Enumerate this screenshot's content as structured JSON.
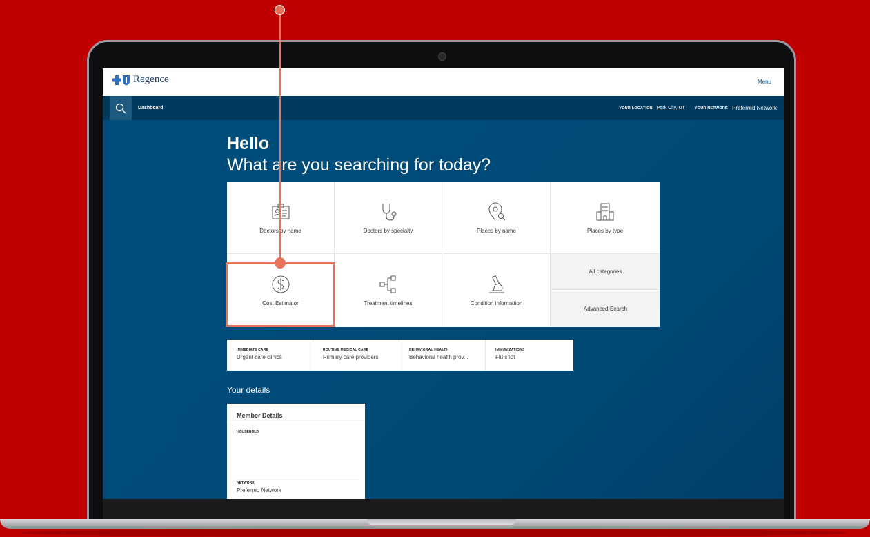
{
  "app": {
    "brand": "Regence",
    "menu_label": "Menu"
  },
  "nav": {
    "dashboard_label": "Dashboard",
    "location_caption": "YOUR LOCATION",
    "location_value": "Park City, UT",
    "network_caption": "YOUR NETWORK",
    "network_value": "Preferred Network"
  },
  "hero": {
    "greeting": "Hello",
    "question": "What are you searching for today?"
  },
  "categories": [
    {
      "label": "Doctors by name",
      "icon": "id-card-icon"
    },
    {
      "label": "Doctors by specialty",
      "icon": "stethoscope-icon"
    },
    {
      "label": "Places by name",
      "icon": "location-search-icon"
    },
    {
      "label": "Places by type",
      "icon": "building-icon"
    },
    {
      "label": "Cost Estimator",
      "icon": "dollar-icon"
    },
    {
      "label": "Treatment timelines",
      "icon": "timeline-icon"
    },
    {
      "label": "Condition information",
      "icon": "microscope-icon"
    }
  ],
  "side_links": {
    "all_categories": "All categories",
    "advanced_search": "Advanced Search"
  },
  "quick_links": [
    {
      "caption": "IMMEDIATE CARE",
      "value": "Urgent care clinics"
    },
    {
      "caption": "ROUTINE MEDICAL CARE",
      "value": "Primary care providers"
    },
    {
      "caption": "BEHAVIORAL HEALTH",
      "value": "Behavioral health prov..."
    },
    {
      "caption": "IMMUNIZATIONS",
      "value": "Flu shot"
    }
  ],
  "details": {
    "section_title": "Your details",
    "card_title": "Member Details",
    "household_caption": "HOUSEHOLD",
    "network_caption": "NETWORK",
    "network_value": "Preferred Network"
  },
  "colors": {
    "background": "#c00000",
    "screen_blue": "#004b78",
    "nav_blue": "#003a5e",
    "annotation": "#e8735b"
  }
}
